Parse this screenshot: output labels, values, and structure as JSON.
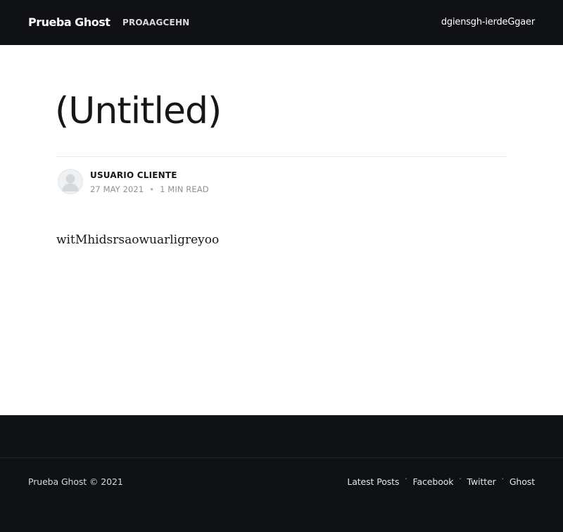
{
  "header": {
    "brand": "Prueba Ghost",
    "nav_items": [
      "PROAAGCEHN"
    ],
    "right_link": "dgiensgh-ierdeGgaer"
  },
  "post": {
    "title": "(Untitled)",
    "author": {
      "name": "USUARIO CLIENTE",
      "avatar_icon": "user-avatar-icon"
    },
    "date": "27 MAY 2021",
    "separator": "•",
    "reading_time": "1 MIN READ",
    "body": "witMhidsrsaowuarligreyoo"
  },
  "footer": {
    "copyright": "Prueba Ghost © 2021",
    "links": [
      "Latest Posts",
      "Facebook",
      "Twitter",
      "Ghost"
    ],
    "separator": "·"
  },
  "colors": {
    "dark": "#0f1114",
    "text": "#15171a",
    "muted": "#8a9198"
  }
}
